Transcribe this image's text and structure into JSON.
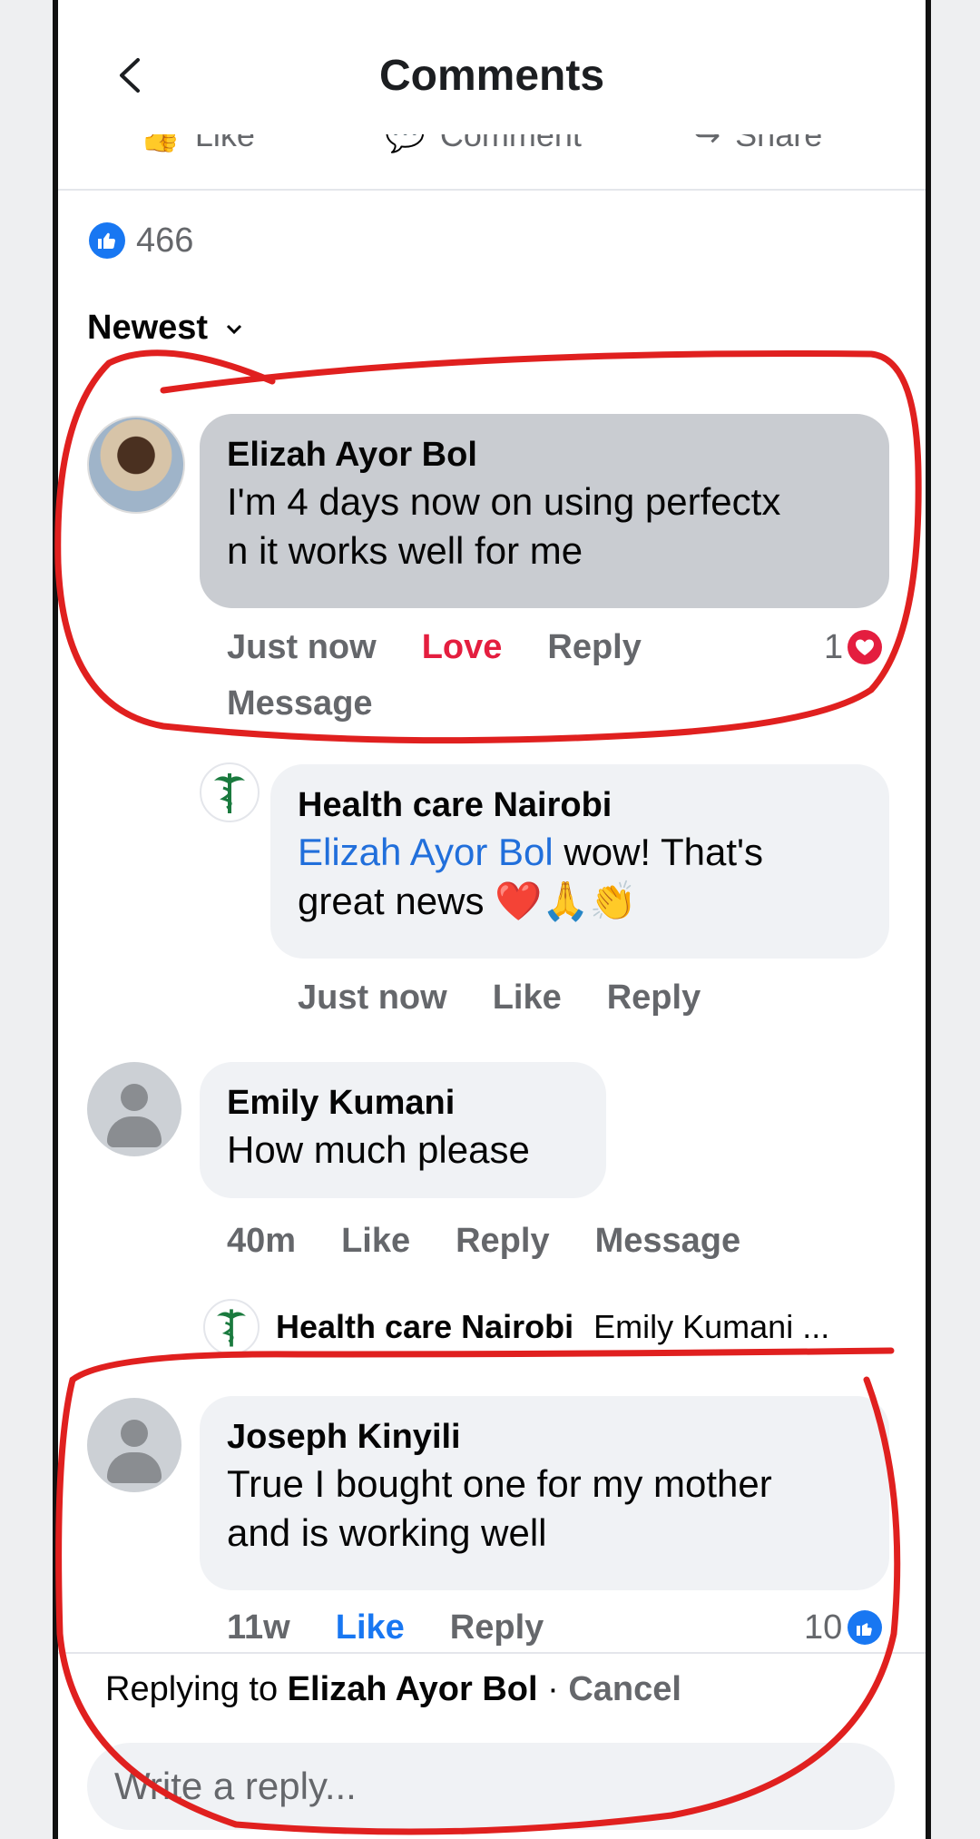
{
  "header": {
    "title": "Comments"
  },
  "action_bar": {
    "like": "Like",
    "comment": "Comment",
    "share": "Share"
  },
  "reactions": {
    "count": "466"
  },
  "sort": {
    "label": "Newest"
  },
  "comments": [
    {
      "author": "Elizah Ayor Bol",
      "text_line1": "I'm 4 days now on using perfectx",
      "text_line2": "n it works well for me",
      "time": "Just now",
      "reaction_action": "Love",
      "reply": "Reply",
      "message": "Message",
      "reaction_count": "1",
      "reply_item": {
        "author": "Health care Nairobi",
        "mention": "Elizah Ayor Bol",
        "text_line1_rest": " wow! That's",
        "text_line2": "great news ❤️🙏👏",
        "time": "Just now",
        "like": "Like",
        "reply": "Reply"
      }
    },
    {
      "author": "Emily Kumani",
      "text": "How much please",
      "time": "40m",
      "like": "Like",
      "reply": "Reply",
      "message": "Message",
      "collapsed_reply": {
        "author": "Health care Nairobi",
        "preview": "Emily Kumani ..."
      }
    },
    {
      "author": "Joseph Kinyili",
      "text_line1": "True I bought one for my mother",
      "text_line2": "and is working well",
      "time": "11w",
      "like": "Like",
      "reply": "Reply",
      "reaction_count": "10"
    }
  ],
  "composer": {
    "replying_prefix": "Replying to ",
    "replying_to": "Elizah Ayor Bol",
    "separator": " · ",
    "cancel": "Cancel",
    "placeholder": "Write a reply..."
  },
  "colors": {
    "accent": "#1877f2",
    "love": "#e41e3f",
    "annotation": "#e0201f"
  }
}
